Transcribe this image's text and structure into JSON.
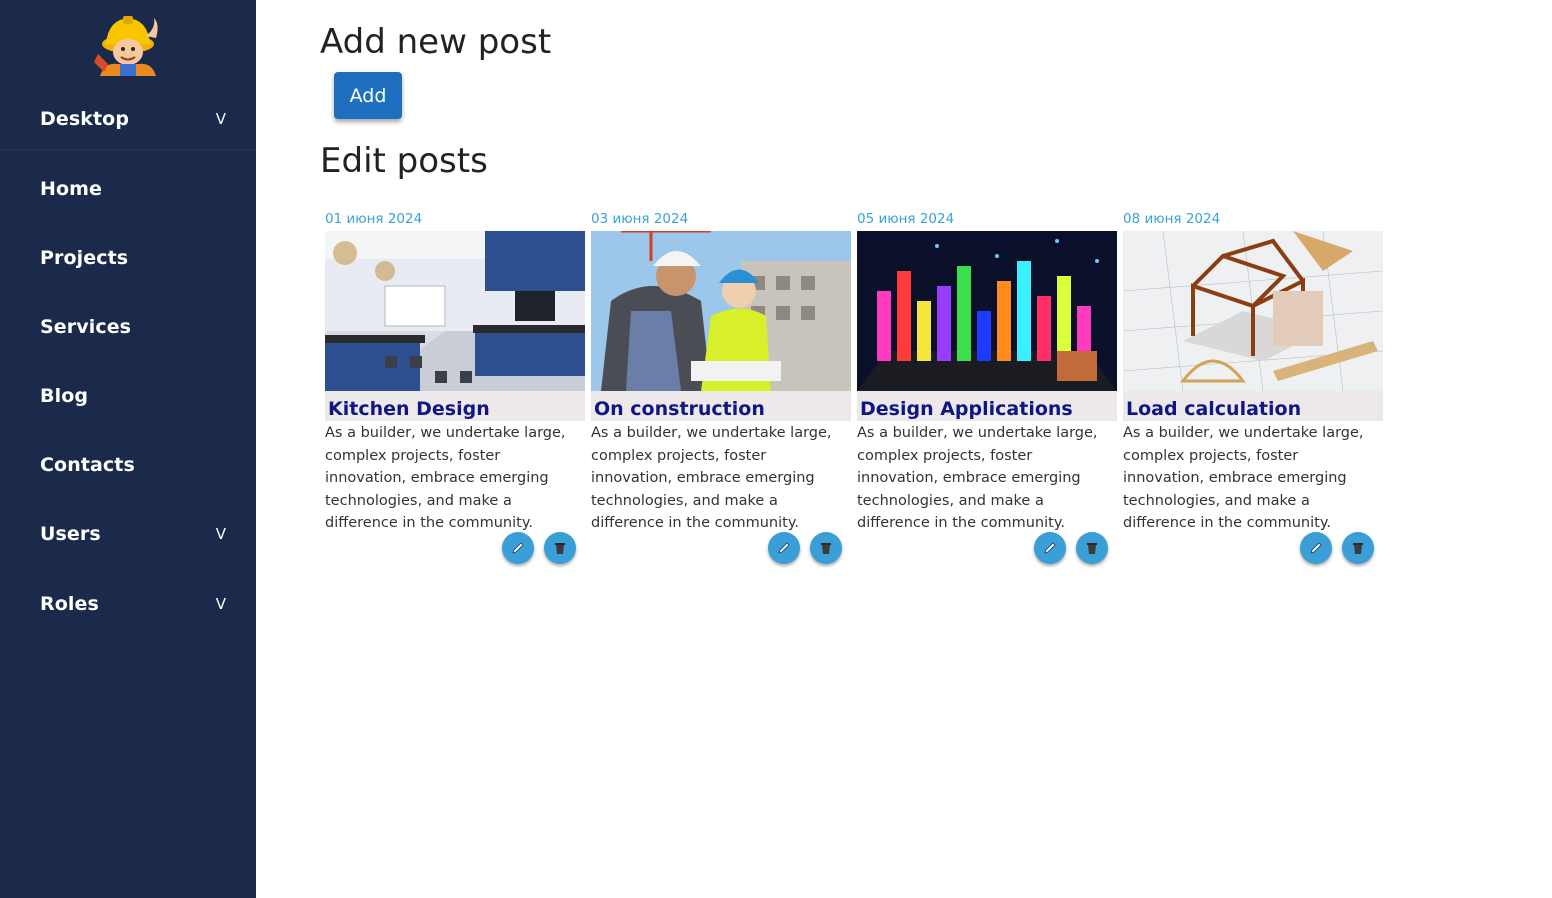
{
  "sidebar": {
    "logo_icon": "builder-mascot-icon",
    "items": [
      {
        "label": "Desktop",
        "caret": "V"
      },
      {
        "label": "Home",
        "caret": ""
      },
      {
        "label": "Projects",
        "caret": ""
      },
      {
        "label": "Services",
        "caret": ""
      },
      {
        "label": "Blog",
        "caret": ""
      },
      {
        "label": "Contacts",
        "caret": ""
      },
      {
        "label": "Users",
        "caret": "V"
      },
      {
        "label": "Roles",
        "caret": "V"
      }
    ]
  },
  "main": {
    "add_heading": "Add new post",
    "add_button": "Add",
    "edit_heading": "Edit posts",
    "posts": [
      {
        "date": "01 июня 2024",
        "title": "Kitchen Design",
        "image": "kitchen-photo",
        "text": "As a builder, we undertake large, complex projects, foster innovation, embrace emerging technologies, and make a difference in the community."
      },
      {
        "date": "03 июня 2024",
        "title": "On construction",
        "image": "construction-workers-photo",
        "text": "As a builder, we undertake large, complex projects, foster innovation, embrace emerging technologies, and make a difference in the community."
      },
      {
        "date": "05 июня 2024",
        "title": "Design Applications",
        "image": "neon-city-model-photo",
        "text": "As a builder, we undertake large, complex projects, foster innovation, embrace emerging technologies, and make a difference in the community."
      },
      {
        "date": "08 июня 2024",
        "title": "Load calculation",
        "image": "house-frame-blueprint-photo",
        "text": "As a builder, we undertake large, complex projects, foster innovation, embrace emerging technologies, and make a difference in the community."
      }
    ],
    "post_actions": {
      "edit_icon": "pencil-icon",
      "delete_icon": "trash-icon"
    }
  },
  "colors": {
    "sidebar_bg": "#1b2a4a",
    "accent_blue": "#1f6fc1",
    "date_color": "#3aa2d6",
    "title_color": "#101684",
    "title_bg": "#ede9ea",
    "action_button": "#3a9fd6"
  }
}
